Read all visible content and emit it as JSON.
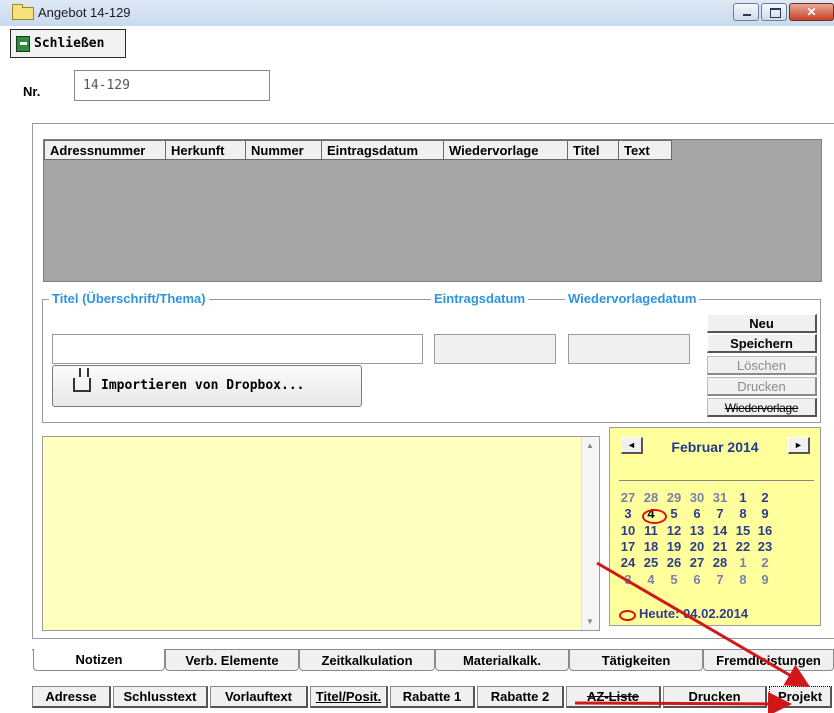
{
  "window": {
    "title": "Angebot 14-129",
    "min_glyph": "",
    "max_glyph": "",
    "close_glyph": "✕"
  },
  "toolbar": {
    "close_label": "Schließen"
  },
  "number": {
    "label": "Nr.",
    "value": "14-129"
  },
  "grid": {
    "columns": [
      "Adressnummer",
      "Herkunft",
      "Nummer",
      "Eintragsdatum",
      "Wiedervorlage",
      "Titel",
      "Text"
    ]
  },
  "form": {
    "title_legend": "Titel (Überschrift/Thema)",
    "entry_date_legend": "Eintragsdatum",
    "followup_legend": "Wiedervorlagedatum",
    "title_value": "",
    "entry_date_value": "",
    "followup_value": "",
    "import_button": "Importieren von Dropbox..."
  },
  "actions": {
    "new": "Neu",
    "save": "Speichern",
    "delete": "Löschen",
    "print": "Drucken",
    "followup": "Wiedervorlage"
  },
  "notes": {
    "text": ""
  },
  "calendar": {
    "month": "Februar 2014",
    "prev_glyph": "◄",
    "next_glyph": "►",
    "weeks": [
      [
        "27",
        "28",
        "29",
        "30",
        "31",
        "1",
        "2"
      ],
      [
        "3",
        "4",
        "5",
        "6",
        "7",
        "8",
        "9"
      ],
      [
        "10",
        "11",
        "12",
        "13",
        "14",
        "15",
        "16"
      ],
      [
        "17",
        "18",
        "19",
        "20",
        "21",
        "22",
        "23"
      ],
      [
        "24",
        "25",
        "26",
        "27",
        "28",
        "1",
        "2"
      ],
      [
        "3",
        "4",
        "5",
        "6",
        "7",
        "8",
        "9"
      ]
    ],
    "today_label": "Heute: 04.02.2014"
  },
  "tabs": [
    "Notizen",
    "Verb. Elemente",
    "Zeitkalkulation",
    "Materialkalk.",
    "Tätigkeiten",
    "Fremdleistungen"
  ],
  "bottom_tabs": [
    "Adresse",
    "Schlusstext",
    "Vorlauftext",
    "Titel/Posit.",
    "Rabatte 1",
    "Rabatte 2",
    "AZ-Liste",
    "Drucken",
    "Projekt"
  ],
  "colors": {
    "legend": "#2c95dd",
    "notes_bg": "#ffffc0",
    "calendar_bg": "#ffff9c",
    "annotation": "#d01818"
  }
}
